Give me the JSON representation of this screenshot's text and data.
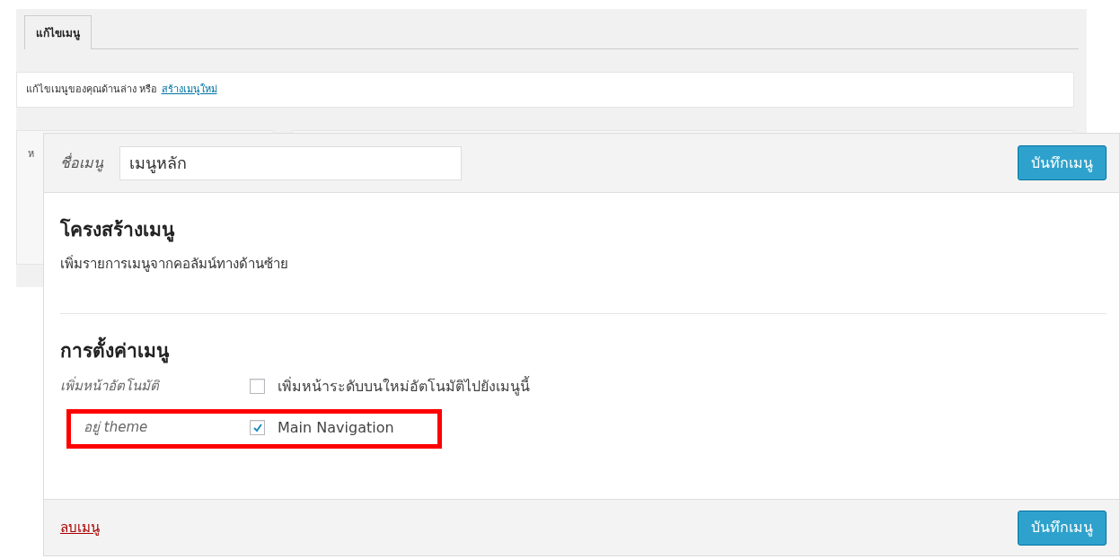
{
  "background": {
    "tabs": [
      {
        "label": "แก้ไขเมนู",
        "selected": true
      }
    ],
    "notice": {
      "text": "แก้ไขเมนูของคุณด้านล่าง หรือ",
      "link": "สร้างเมนูใหม่"
    },
    "left_panel_fragment": "ห"
  },
  "editor": {
    "name_label": "ชื่อเมนู",
    "name_value": "เมนูหลัก",
    "save_button": "บันทึกเมนู",
    "structure": {
      "title": "โครงสร้างเมนู",
      "description": "เพิ่มรายการเมนูจากคอลัมน์ทางด้านซ้าย"
    },
    "settings": {
      "title": "การตั้งค่าเมนู",
      "rows": [
        {
          "label": "เพิ่มหน้าอัตโนมัติ",
          "option": "เพิ่มหน้าระดับบนใหม่อัตโนมัติไปยังเมนูนี้",
          "checked": false
        },
        {
          "label": "อยู่ theme",
          "option": "Main Navigation",
          "checked": true,
          "highlighted": true
        }
      ]
    },
    "delete_link": "ลบเมนู",
    "footer_save_button": "บันทึกเมนู"
  }
}
